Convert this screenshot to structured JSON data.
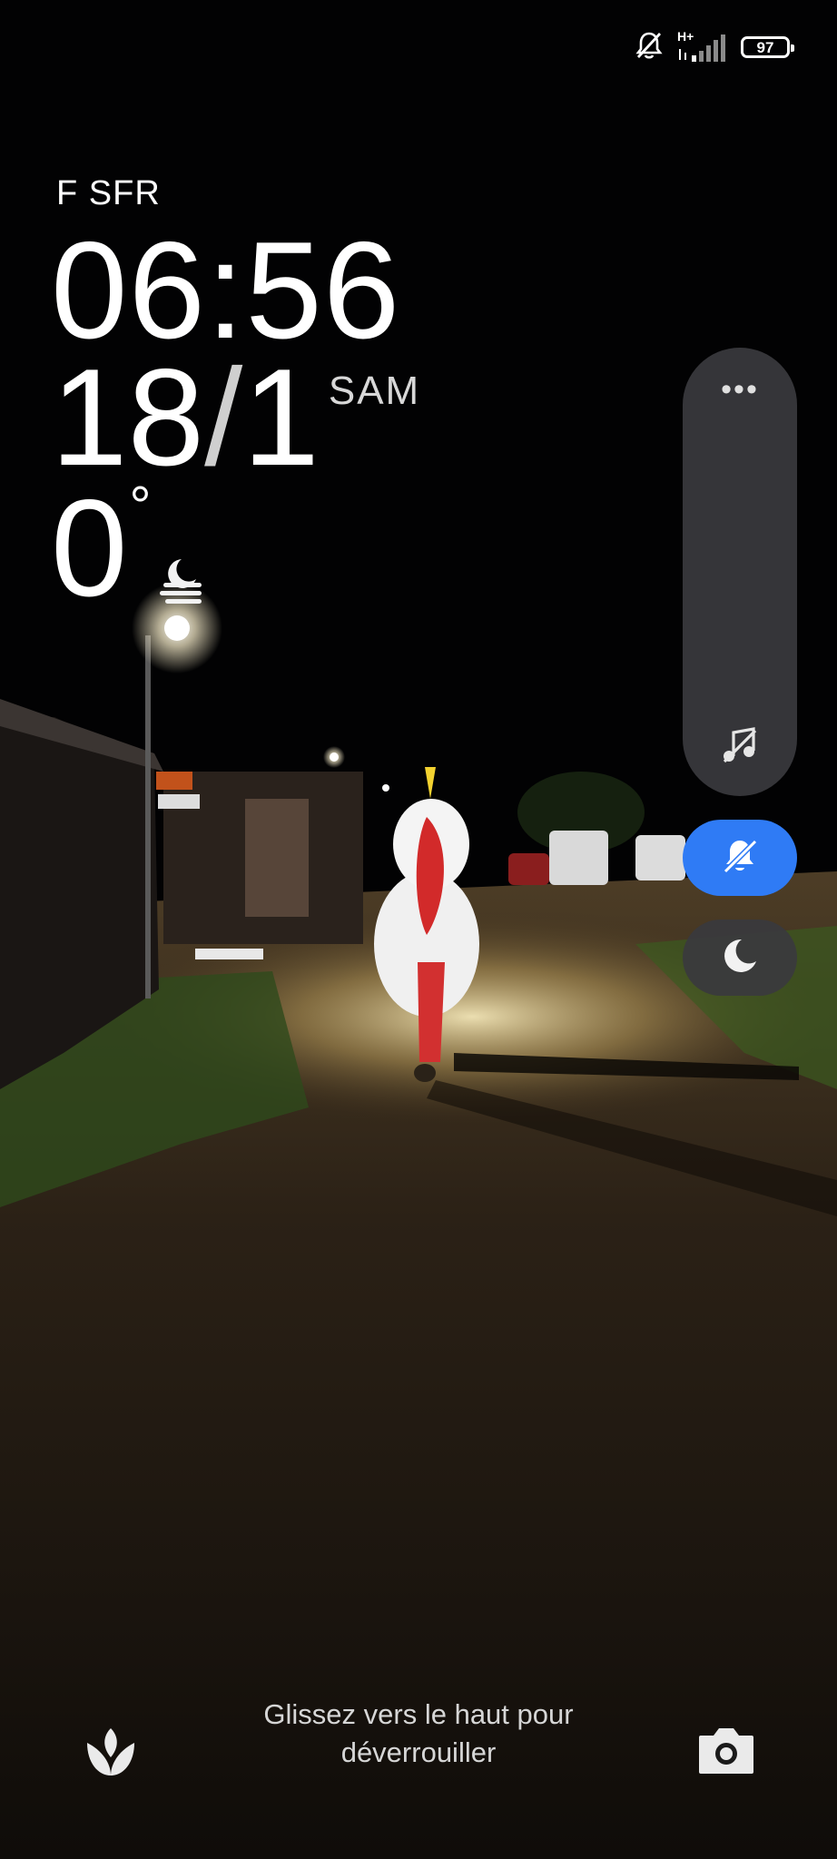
{
  "status_bar": {
    "network_type": "H+",
    "battery_level": "97",
    "icons": [
      "bell-muted-icon",
      "signal-icon",
      "battery-icon"
    ]
  },
  "lock_screen": {
    "carrier": "F SFR",
    "time": "06:56",
    "date_day": "18",
    "date_sep": "/",
    "date_month": "1",
    "day_of_week": "SAM",
    "temperature": "0",
    "temperature_unit": "°",
    "weather_icon": "night-fog-icon"
  },
  "side_panel": {
    "more_label": "•••",
    "buttons": [
      {
        "name": "music-off-icon"
      },
      {
        "name": "bell-off-icon",
        "active": true
      },
      {
        "name": "moon-icon"
      }
    ],
    "accent_color": "#2f7bf5"
  },
  "bottom": {
    "unlock_hint_line1": "Glissez vers le haut pour",
    "unlock_hint_line2": "déverrouiller",
    "left_shortcut_icon": "flower-icon",
    "right_shortcut_icon": "camera-icon"
  }
}
